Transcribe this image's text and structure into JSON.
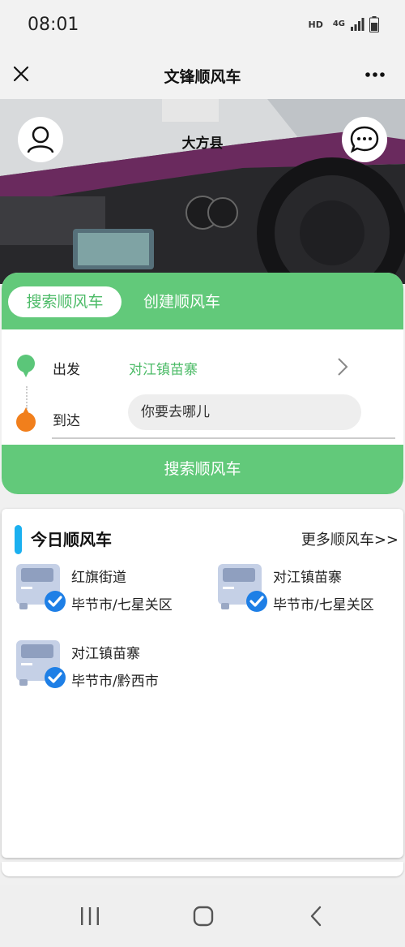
{
  "status_bar": {
    "time": "08:01",
    "hd": "HD",
    "network": "4G"
  },
  "title_bar": {
    "title": "文锋顺风车",
    "close_icon": "close-icon",
    "more_icon": "more-dots-icon"
  },
  "hero": {
    "city": "大方县",
    "avatar_icon": "user-icon",
    "chat_icon": "chat-bubble-icon"
  },
  "search_card": {
    "tabs": [
      {
        "label": "搜索顺风车",
        "active": true
      },
      {
        "label": "创建顺风车",
        "active": false
      }
    ],
    "from_label": "出发",
    "from_value": "对江镇苗寨",
    "to_label": "到达",
    "to_placeholder": "你要去哪儿",
    "search_button": "搜索顺风车"
  },
  "today": {
    "title": "今日顺风车",
    "more_link": "更多顺风车>>",
    "rides": [
      {
        "name": "红旗街道",
        "city": "毕节市/七星关区"
      },
      {
        "name": "对江镇苗寨",
        "city": "毕节市/七星关区"
      },
      {
        "name": "对江镇苗寨",
        "city": "毕节市/黔西市"
      }
    ]
  },
  "colors": {
    "accent_green": "#62c97a",
    "accent_blue": "#1bb0f0",
    "from_pin": "#5bc679",
    "to_pin": "#f17f1c",
    "check_blue": "#1e7fe6"
  }
}
